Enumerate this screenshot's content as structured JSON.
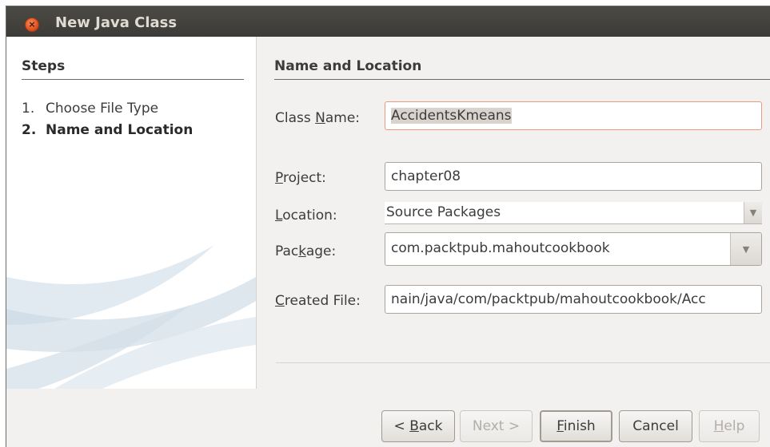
{
  "window": {
    "title": "New Java Class",
    "close_glyph": "×"
  },
  "steps": {
    "heading": "Steps",
    "items": [
      {
        "num": "1.",
        "label": "Choose File Type"
      },
      {
        "num": "2.",
        "label": "Name and Location"
      }
    ]
  },
  "panel": {
    "heading": "Name and Location"
  },
  "fields": {
    "class_name": {
      "label_pre": "Class ",
      "label_mn": "N",
      "label_post": "ame:",
      "value": "AccidentsKmeans"
    },
    "project": {
      "label_pre": "",
      "label_mn": "P",
      "label_post": "roject:",
      "value": "chapter08"
    },
    "location": {
      "label_pre": "",
      "label_mn": "L",
      "label_post": "ocation:",
      "value": "Source Packages"
    },
    "package": {
      "label_pre": "Pac",
      "label_mn": "k",
      "label_post": "age:",
      "value": "com.packtpub.mahoutcookbook"
    },
    "created_file": {
      "label_pre": "",
      "label_mn": "C",
      "label_post": "reated File:",
      "value": "nain/java/com/packtpub/mahoutcookbook/Acc"
    }
  },
  "icons": {
    "dropdown": "chevron-down-icon",
    "close": "close-icon",
    "arrow_glyph": "▼"
  },
  "buttons": {
    "back": {
      "pre": "< ",
      "mn": "B",
      "post": "ack"
    },
    "next": {
      "pre": "",
      "mn": "",
      "post": "Next >"
    },
    "finish": {
      "pre": "",
      "mn": "F",
      "post": "inish"
    },
    "cancel": {
      "pre": "",
      "mn": "",
      "post": "Cancel"
    },
    "help": {
      "pre": "",
      "mn": "H",
      "post": "elp"
    }
  },
  "colors": {
    "titlebar": "#3c3b37",
    "close_button": "#df4a16",
    "focus_border": "#e89b7e"
  }
}
